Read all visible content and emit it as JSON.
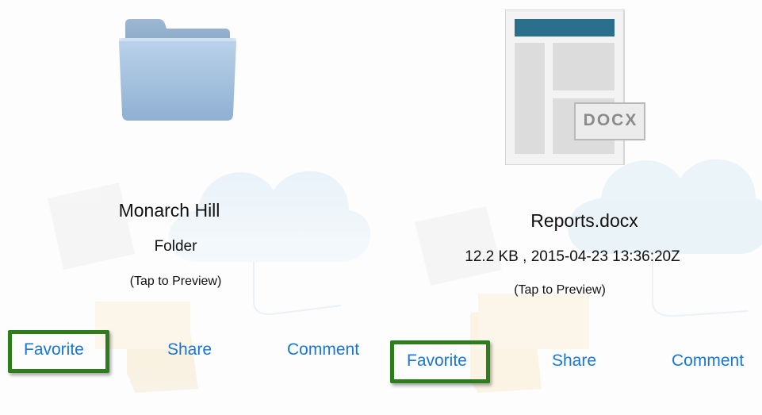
{
  "items": [
    {
      "icon": "folder-icon",
      "name": "Monarch Hill",
      "detail": "Folder",
      "hint": "(Tap to Preview)",
      "actions": {
        "favorite": "Favorite",
        "share": "Share",
        "comment": "Comment"
      }
    },
    {
      "icon": "docx-file-icon",
      "icon_badge": "DOCX",
      "name": "Reports.docx",
      "detail": "12.2 KB , 2015-04-23 13:36:20Z",
      "hint": "(Tap to Preview)",
      "actions": {
        "favorite": "Favorite",
        "share": "Share",
        "comment": "Comment"
      }
    }
  ],
  "colors": {
    "action": "#1877d6",
    "highlight": "#2e7d1c"
  }
}
